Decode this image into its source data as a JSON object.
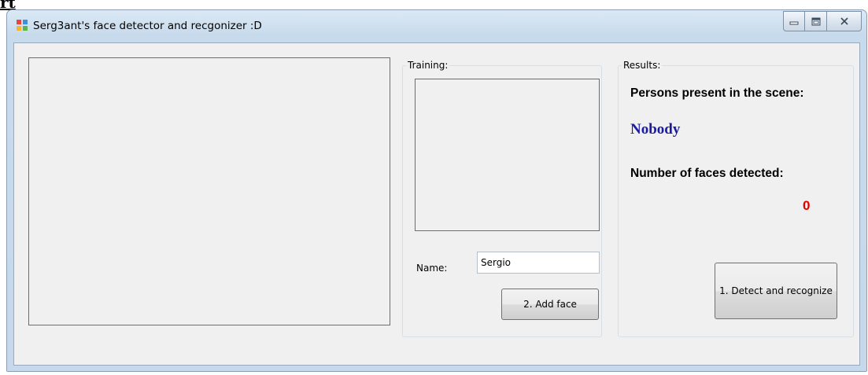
{
  "corner_glyph": "rt",
  "window": {
    "title": "Serg3ant's face detector and recgonizer :D",
    "icon": "app-window-icon",
    "caption_buttons": [
      "minimize-icon",
      "maximize-icon",
      "close-icon"
    ]
  },
  "training": {
    "group_label": "Training:",
    "name_label": "Name:",
    "name_value": "Sergio",
    "add_button": "2. Add face"
  },
  "results": {
    "group_label": "Results:",
    "persons_heading": "Persons present in the scene:",
    "persons_value": "Nobody",
    "faces_heading": "Number of faces detected:",
    "faces_value": "0",
    "detect_button": "1. Detect and recognize"
  },
  "colors": {
    "persons_value": "#1a1aa6",
    "faces_value": "#e00000",
    "client_background": "#f0f0f0"
  }
}
